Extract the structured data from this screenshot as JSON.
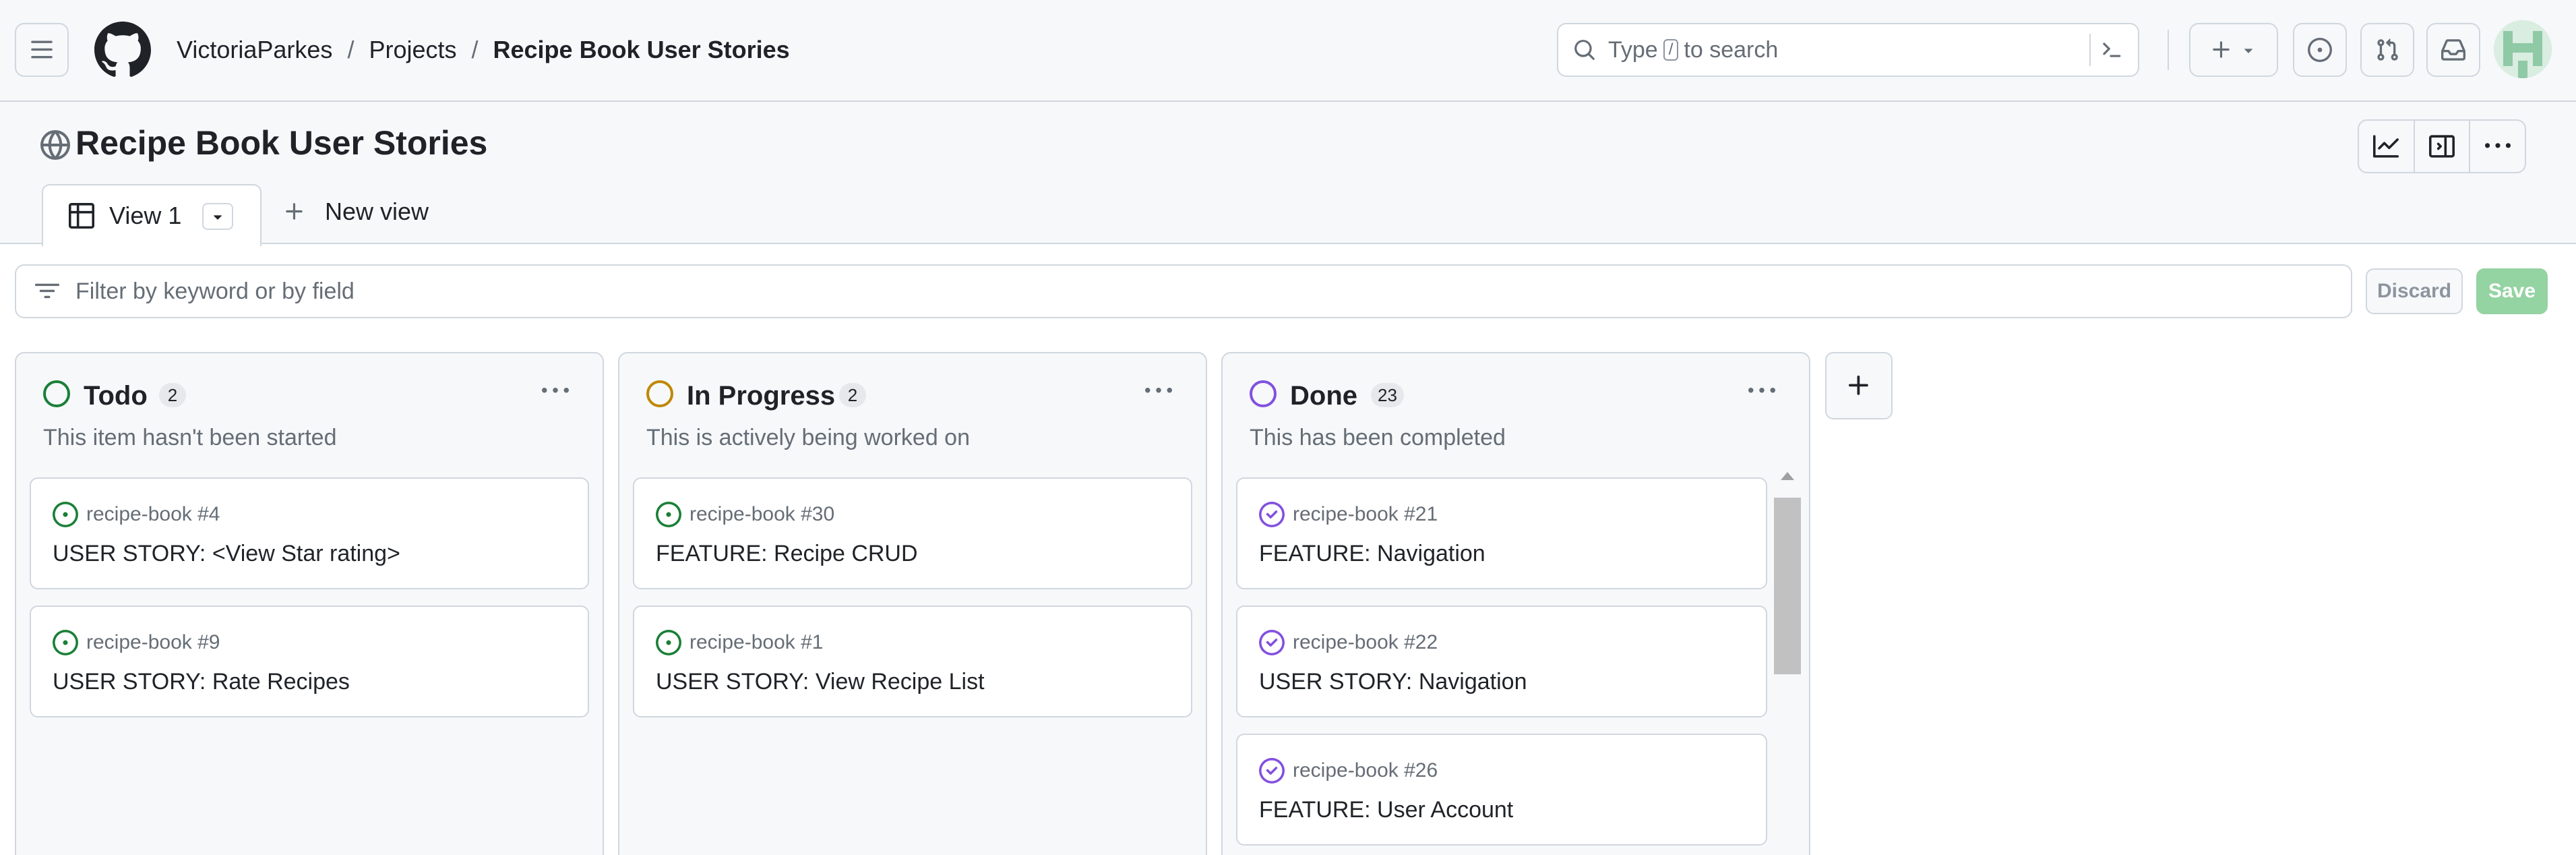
{
  "header": {
    "breadcrumbs": [
      "VictoriaParkes",
      "Projects",
      "Recipe Book User Stories"
    ],
    "separator": "/",
    "search": {
      "prefix": "Type",
      "key": "/",
      "suffix": "to search"
    },
    "icons": [
      "menu-icon",
      "github-logo-icon",
      "search-icon",
      "command-palette-icon",
      "plus-icon",
      "chevron-down-icon",
      "issue-icon",
      "pull-request-icon",
      "inbox-icon"
    ]
  },
  "project": {
    "title": "Recipe Book User Stories",
    "visibility_icon": "globe-icon",
    "toolbar_icons": [
      "insights-icon",
      "side-panel-icon",
      "kebab-icon"
    ]
  },
  "views": {
    "active": "View 1",
    "new_view": "New view"
  },
  "filter": {
    "placeholder": "Filter by keyword or by field",
    "discard": "Discard",
    "save": "Save"
  },
  "columns": [
    {
      "name": "Todo",
      "count": "2",
      "description": "This item hasn't been started",
      "color": "#1a7f37",
      "cards": [
        {
          "repo": "recipe-book #4",
          "title": "USER STORY: <View Star rating>"
        },
        {
          "repo": "recipe-book #9",
          "title": "USER STORY: Rate Recipes"
        }
      ]
    },
    {
      "name": "In Progress",
      "count": "2",
      "description": "This is actively being worked on",
      "color": "#bf8700",
      "cards": [
        {
          "repo": "recipe-book #30",
          "title": "FEATURE: Recipe CRUD"
        },
        {
          "repo": "recipe-book #1",
          "title": "USER STORY: View Recipe List"
        }
      ]
    },
    {
      "name": "Done",
      "count": "23",
      "description": "This has been completed",
      "color": "#8250df",
      "cards": [
        {
          "repo": "recipe-book #21",
          "title": "FEATURE: Navigation"
        },
        {
          "repo": "recipe-book #22",
          "title": "USER STORY: Navigation"
        },
        {
          "repo": "recipe-book #26",
          "title": "FEATURE: User Account"
        }
      ]
    }
  ],
  "colors": {
    "open_issue": "#1a7f37",
    "closed_issue": "#8250df",
    "save_button": "#94d3a2"
  }
}
